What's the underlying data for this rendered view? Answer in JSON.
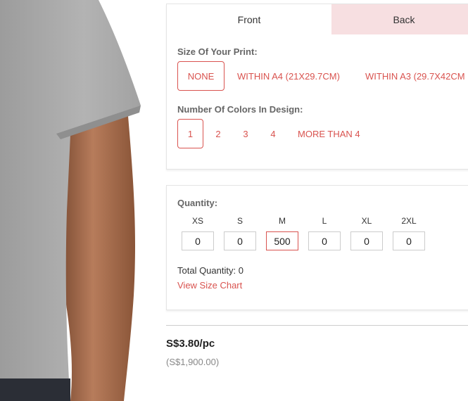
{
  "tabs": {
    "front": "Front",
    "back": "Back"
  },
  "print_size": {
    "label": "Size Of Your Print:",
    "options": [
      "NONE",
      "WITHIN A4 (21X29.7CM)",
      "WITHIN A3 (29.7X42CM"
    ],
    "selected": "NONE"
  },
  "colors": {
    "label": "Number Of Colors In Design:",
    "options": [
      "1",
      "2",
      "3",
      "4",
      "MORE THAN 4"
    ],
    "selected": "1"
  },
  "quantity": {
    "label": "Quantity:",
    "sizes": [
      {
        "size": "XS",
        "value": "0"
      },
      {
        "size": "S",
        "value": "0"
      },
      {
        "size": "M",
        "value": "500"
      },
      {
        "size": "L",
        "value": "0"
      },
      {
        "size": "XL",
        "value": "0"
      },
      {
        "size": "2XL",
        "value": "0"
      }
    ],
    "total_label": "Total Quantity: 0",
    "size_chart_link": "View Size Chart"
  },
  "pricing": {
    "unit_price": "S$3.80/pc",
    "total_price": "(S$1,900.00)"
  },
  "colors_palette": {
    "accent": "#d9534f",
    "tab_inactive_bg": "#f7dfe1",
    "shirt": "#a9a9a9"
  }
}
